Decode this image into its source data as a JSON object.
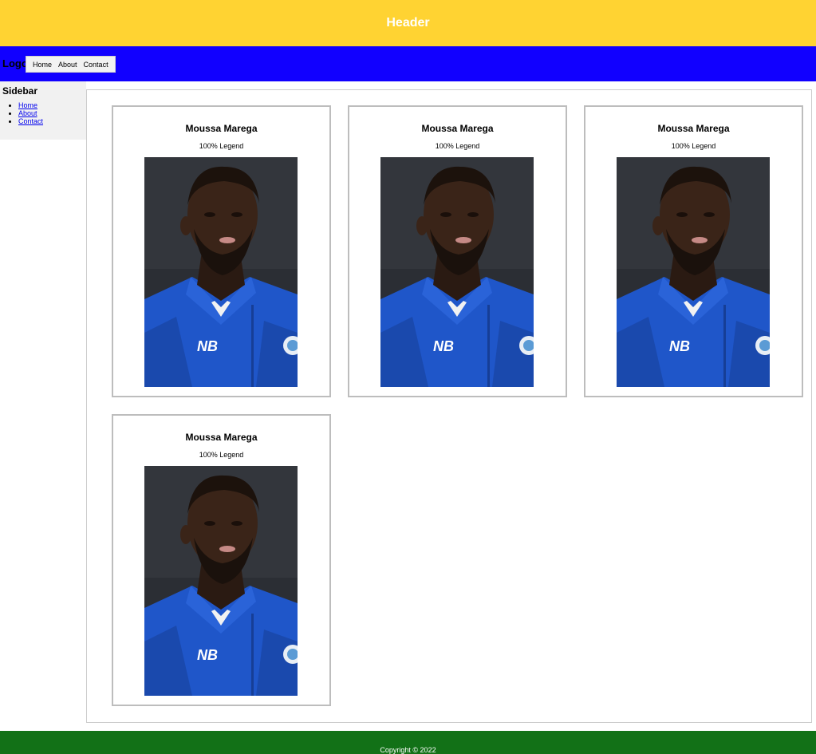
{
  "header": {
    "title": "Header",
    "bg_color": "#ffd332"
  },
  "nav": {
    "logo": "Logo",
    "bg_color": "#1100ff",
    "items": [
      {
        "label": "Home"
      },
      {
        "label": "About"
      },
      {
        "label": "Contact"
      }
    ]
  },
  "sidebar": {
    "title": "Sidebar",
    "links": [
      {
        "label": "Home"
      },
      {
        "label": "About"
      },
      {
        "label": "Contact"
      }
    ]
  },
  "cards": [
    {
      "name": "Moussa Marega",
      "caption": "100% Legend",
      "image": "player-photo"
    },
    {
      "name": "Moussa Marega",
      "caption": "100% Legend",
      "image": "player-photo"
    },
    {
      "name": "Moussa Marega",
      "caption": "100% Legend",
      "image": "player-photo"
    },
    {
      "name": "Moussa Marega",
      "caption": "100% Legend",
      "image": "player-photo"
    }
  ],
  "footer": {
    "text": "Copyright © 2022",
    "bg_color": "#127117"
  }
}
